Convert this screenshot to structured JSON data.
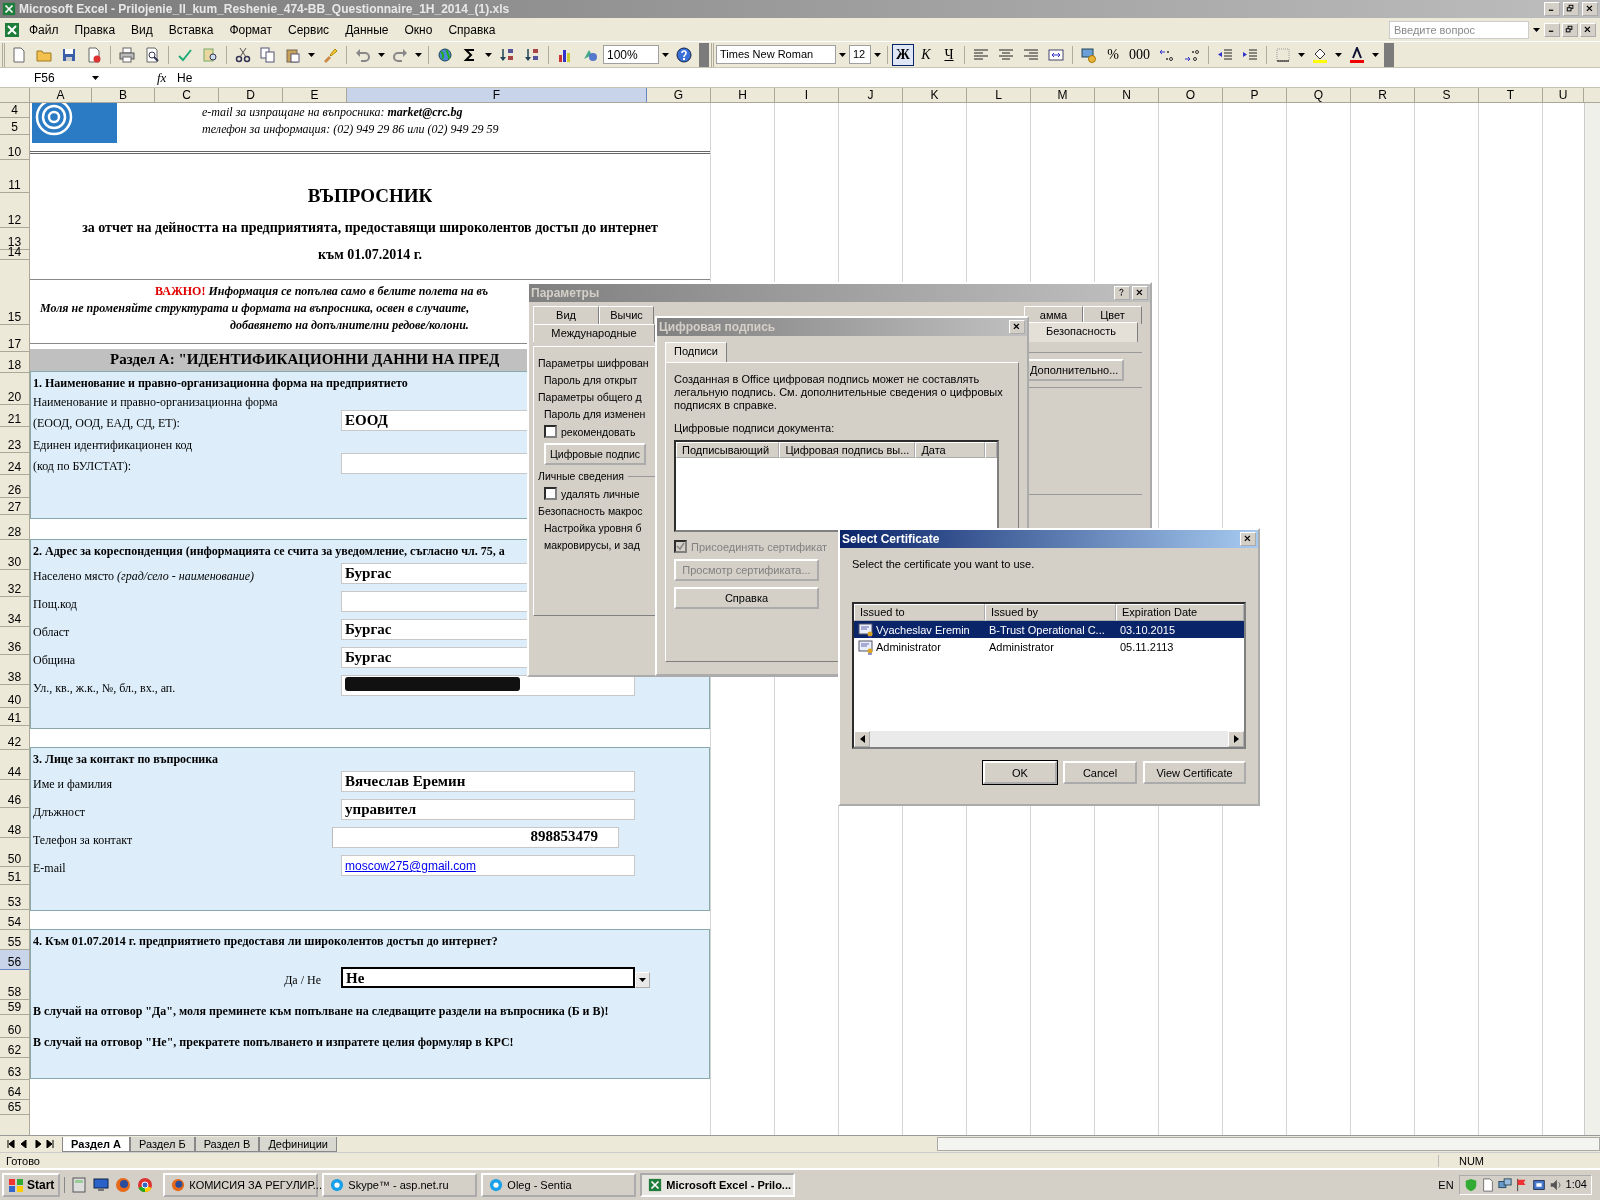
{
  "window": {
    "title": "Microsoft Excel - Prilojenie_II_kum_Reshenie_474-BB_Questionnaire_1H_2014_(1).xls"
  },
  "menu": [
    "Файл",
    "Правка",
    "Вид",
    "Вставка",
    "Формат",
    "Сервис",
    "Данные",
    "Окно",
    "Справка"
  ],
  "help_box": {
    "placeholder": "Введите вопрос"
  },
  "toolbar": {
    "zoom": "100%",
    "font": "Times New Roman",
    "size": "12",
    "format_buttons": [
      {
        "label": "Ж",
        "selected": true
      },
      {
        "label": "К",
        "selected": false
      },
      {
        "label": "Ч",
        "selected": false
      }
    ],
    "number_buttons": [
      "%",
      "000"
    ]
  },
  "formula_bar": {
    "cell": "F56",
    "function_label": "fx",
    "value": "Не"
  },
  "sheet": {
    "columns": [
      {
        "label": "A",
        "selected": false
      },
      {
        "label": "B",
        "selected": false
      },
      {
        "label": "C",
        "selected": false
      },
      {
        "label": "D",
        "selected": false
      },
      {
        "label": "E",
        "selected": false
      },
      {
        "label": "F",
        "selected": true
      },
      {
        "label": "G",
        "selected": false
      },
      {
        "label": "H",
        "selected": false
      },
      {
        "label": "I",
        "selected": false
      },
      {
        "label": "J",
        "selected": false
      },
      {
        "label": "K",
        "selected": false
      },
      {
        "label": "L",
        "selected": false
      },
      {
        "label": "M",
        "selected": false
      },
      {
        "label": "N",
        "selected": false
      },
      {
        "label": "O",
        "selected": false
      },
      {
        "label": "P",
        "selected": false
      },
      {
        "label": "Q",
        "selected": false
      },
      {
        "label": "R",
        "selected": false
      },
      {
        "label": "S",
        "selected": false
      },
      {
        "label": "T",
        "selected": false
      },
      {
        "label": "U",
        "selected": false
      }
    ],
    "rows": [
      {
        "label": "4",
        "selected": false
      },
      {
        "label": "5",
        "selected": false
      },
      {
        "label": "10",
        "selected": false
      },
      {
        "label": "11",
        "selected": false
      },
      {
        "label": "12",
        "selected": false
      },
      {
        "label": "13",
        "selected": false
      },
      {
        "label": "14",
        "selected": false
      },
      {
        "label": "15",
        "selected": false
      },
      {
        "label": "17",
        "selected": false
      },
      {
        "label": "18",
        "selected": false
      },
      {
        "label": "20",
        "selected": false
      },
      {
        "label": "21",
        "selected": false
      },
      {
        "label": "23",
        "selected": false
      },
      {
        "label": "24",
        "selected": false
      },
      {
        "label": "26",
        "selected": false
      },
      {
        "label": "27",
        "selected": false
      },
      {
        "label": "28",
        "selected": false
      },
      {
        "label": "30",
        "selected": false
      },
      {
        "label": "32",
        "selected": false
      },
      {
        "label": "34",
        "selected": false
      },
      {
        "label": "36",
        "selected": false
      },
      {
        "label": "38",
        "selected": false
      },
      {
        "label": "40",
        "selected": false
      },
      {
        "label": "41",
        "selected": false
      },
      {
        "label": "42",
        "selected": false
      },
      {
        "label": "44",
        "selected": false
      },
      {
        "label": "46",
        "selected": false
      },
      {
        "label": "48",
        "selected": false
      },
      {
        "label": "50",
        "selected": false
      },
      {
        "label": "51",
        "selected": false
      },
      {
        "label": "53",
        "selected": false
      },
      {
        "label": "54",
        "selected": false
      },
      {
        "label": "55",
        "selected": false
      },
      {
        "label": "56",
        "selected": true
      },
      {
        "label": "58",
        "selected": false
      },
      {
        "label": "59",
        "selected": false
      },
      {
        "label": "60",
        "selected": false
      },
      {
        "label": "62",
        "selected": false
      },
      {
        "label": "63",
        "selected": false
      },
      {
        "label": "64",
        "selected": false
      },
      {
        "label": "65",
        "selected": false
      }
    ]
  },
  "form": {
    "email_line": "e-mail за изпращане на въпросника: **market@crc.bg**",
    "phone_line": "телефон за информация: (02) 949 29 86 или (02) 949 29 59",
    "title": "ВЪПРОСНИК",
    "subtitle": "за отчет на дейността на предприятията, предоставящи широколентов достъп до интернет",
    "date": "към 01.07.2014 г.",
    "notice": {
      "important": "ВАЖНО!",
      "lines": [
        "Информация се попълва само в белите полета на въ",
        "Моля не променяйте структурата и формата на въпросника, освен в случаите,",
        "добавянето на допълнителни редове/колони."
      ]
    },
    "section_header": "Раздел А: \"ИДЕНТИФИКАЦИОННИ ДАННИ НА ПРЕД",
    "blocks": [
      {
        "heading": "1. Наименование и правно-организационна форма на предприятието",
        "fields": [
          {
            "kind": "text",
            "label_lines": [
              "Наименование и правно-организационна форма",
              "(ЕООД, ООД, ЕАД, СД, ЕТ):"
            ],
            "value": "ЕООД"
          },
          {
            "kind": "empty",
            "label_lines": [
              "Единен идентификационен код",
              "(код по БУЛСТАТ):"
            ]
          }
        ]
      },
      {
        "heading": "2. Адрес за кореспонденция (информацията се счита за уведомление, съгласно чл. 75, а",
        "fields": [
          {
            "kind": "text",
            "label_lines": [
              "Населено място *(град/село - наименование)*"
            ],
            "value": "Бургас"
          },
          {
            "kind": "empty",
            "label_lines": [
              "Пощ.код"
            ]
          },
          {
            "kind": "text",
            "label_lines": [
              "Област"
            ],
            "value": "Бургас"
          },
          {
            "kind": "text",
            "label_lines": [
              "Община"
            ],
            "value": "Бургас"
          },
          {
            "kind": "redacted",
            "label_lines": [
              "Ул., кв., ж.к., №, бл., вх., ап."
            ]
          }
        ]
      },
      {
        "heading": "3. Лице за контакт по въпросника",
        "fields": [
          {
            "kind": "text",
            "label_lines": [
              "Име и фамилия"
            ],
            "value": "Вячеслав Еремин"
          },
          {
            "kind": "text",
            "label_lines": [
              "Длъжност"
            ],
            "value": "управител"
          },
          {
            "kind": "number",
            "label_lines": [
              "Телефон за контакт"
            ],
            "value": "898853479"
          },
          {
            "kind": "link",
            "label_lines": [
              "E-mail"
            ],
            "value": "moscow275@gmail.com"
          }
        ]
      },
      {
        "heading": "4. Към 01.07.2014 г. предприятието предоставя ли широколентов достъп до интернет?",
        "fields": [
          {
            "kind": "dropdown",
            "label_lines": [
              "Да / Не"
            ],
            "value": "Не"
          }
        ],
        "notes": [
          "В случай на отговор \"Да\", моля преминете към попълване на следващите раздели на въпросника (Б и В)!",
          "В случай на отговор \"Не\", прекратете попълването и изпратете целия формуляр в КРС!"
        ]
      }
    ]
  },
  "options_dialog": {
    "title": "Параметры",
    "tabs_row1": [
      {
        "label": "Вид",
        "selected": false
      },
      {
        "label": "Вычис",
        "selected": false
      },
      {
        "label": "амма",
        "selected": false
      },
      {
        "label": "Цвет",
        "selected": false
      }
    ],
    "tabs_row2": [
      {
        "label": "Международные",
        "selected": false
      },
      {
        "label": "Безопасность",
        "selected": true
      }
    ],
    "items": [
      {
        "kind": "heading",
        "text": "Параметры шифрован"
      },
      {
        "kind": "text",
        "text": "Пароль для открыт"
      },
      {
        "kind": "heading",
        "text": "Параметры общего д"
      },
      {
        "kind": "text",
        "text": "Пароль для изменен"
      },
      {
        "kind": "checkbox",
        "text": "рекомендовать",
        "checked": false
      },
      {
        "kind": "button",
        "text": "Цифровые подпис"
      },
      {
        "kind": "group",
        "text": "Личные сведения"
      },
      {
        "kind": "checkbox",
        "text": "удалять личные",
        "checked": false
      },
      {
        "kind": "heading",
        "text": "Безопасность макрос"
      },
      {
        "kind": "text",
        "text": "Настройка уровня б"
      },
      {
        "kind": "text",
        "text": "макровирусы, и зад"
      }
    ],
    "more_button": "Дополнительно..."
  },
  "signature_dialog": {
    "title": "Цифровая подпись",
    "tabs": [
      {
        "label": "Подписи",
        "selected": true
      }
    ],
    "info": "Созданная в Office цифровая подпись может не составлять легальную подпись. См. дополнительные сведения о цифровых подписях в справке.",
    "list_label": "Цифровые подписи документа:",
    "columns": [
      "Подписывающий",
      "Цифровая подпись вы...",
      "Дата"
    ],
    "attach": {
      "label": "Присоединять сертификат",
      "checked": true,
      "disabled": true
    },
    "buttons": [
      {
        "label": "Просмотр сертификата...",
        "disabled": true
      },
      {
        "label": "Справка",
        "disabled": false
      }
    ]
  },
  "certificate_dialog": {
    "title": "Select Certificate",
    "prompt": "Select the certificate you want to use.",
    "columns": [
      "Issued to",
      "Issued by",
      "Expiration Date"
    ],
    "rows": [
      {
        "issued_to": "Vyacheslav Eremin",
        "issued_by": "B-Trust Operational C...",
        "expires": "03.10.2015",
        "selected": true
      },
      {
        "issued_to": "Administrator",
        "issued_by": "Administrator",
        "expires": "05.11.2113",
        "selected": false
      }
    ],
    "buttons": [
      {
        "label": "OK",
        "default": true
      },
      {
        "label": "Cancel",
        "default": false
      },
      {
        "label": "View Certificate",
        "default": false
      }
    ]
  },
  "sheet_tabs": [
    {
      "label": "Раздел А",
      "selected": true
    },
    {
      "label": "Раздел Б",
      "selected": false
    },
    {
      "label": "Раздел В",
      "selected": false
    },
    {
      "label": "Дефиниции",
      "selected": false
    }
  ],
  "status_bar": {
    "text": "Готово",
    "indicator": "NUM"
  },
  "taskbar": {
    "start": "Start",
    "tasks": [
      {
        "label": "КОМИСИЯ ЗА РЕГУЛИР...",
        "selected": false
      },
      {
        "label": "Skype™ - asp.net.ru",
        "selected": false
      },
      {
        "label": "Oleg - Sentia",
        "selected": false
      },
      {
        "label": "Microsoft Excel - Prilo...",
        "selected": true
      }
    ],
    "language": "EN",
    "clock": "1:04"
  }
}
